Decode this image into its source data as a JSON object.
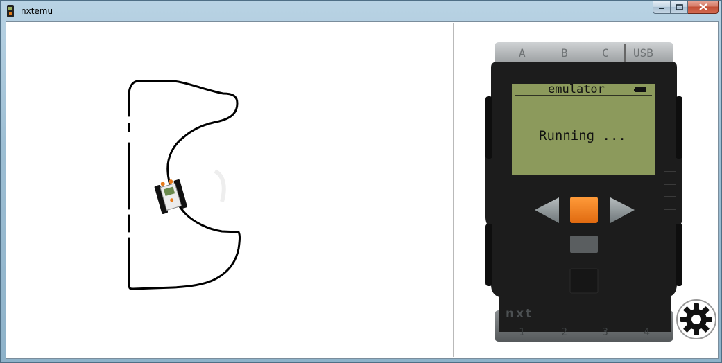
{
  "window": {
    "title": "nxtemu",
    "caption_buttons": [
      {
        "name": "minimize",
        "icon": "minimize-icon"
      },
      {
        "name": "maximize",
        "icon": "maximize-icon"
      },
      {
        "name": "close",
        "icon": "close-icon"
      }
    ]
  },
  "nxt": {
    "ports_top": [
      "A",
      "B",
      "C",
      "USB"
    ],
    "ports_bottom": [
      "1",
      "2",
      "3",
      "4"
    ],
    "screen": {
      "title": "emulator",
      "status": "Running ..."
    },
    "brand": "nxt",
    "buttons": {
      "left": "left-arrow-icon",
      "enter": "orange-enter",
      "right": "right-arrow-icon",
      "back": "dark-gray-back"
    }
  },
  "settings": {
    "icon": "gear-icon"
  },
  "colors": {
    "screen_bg": "#8c9a5c",
    "brick_body": "#1c1c1c",
    "enter_button": "#f07a1c",
    "arrow_button": "#8a9496",
    "back_button": "#5a5e60"
  }
}
